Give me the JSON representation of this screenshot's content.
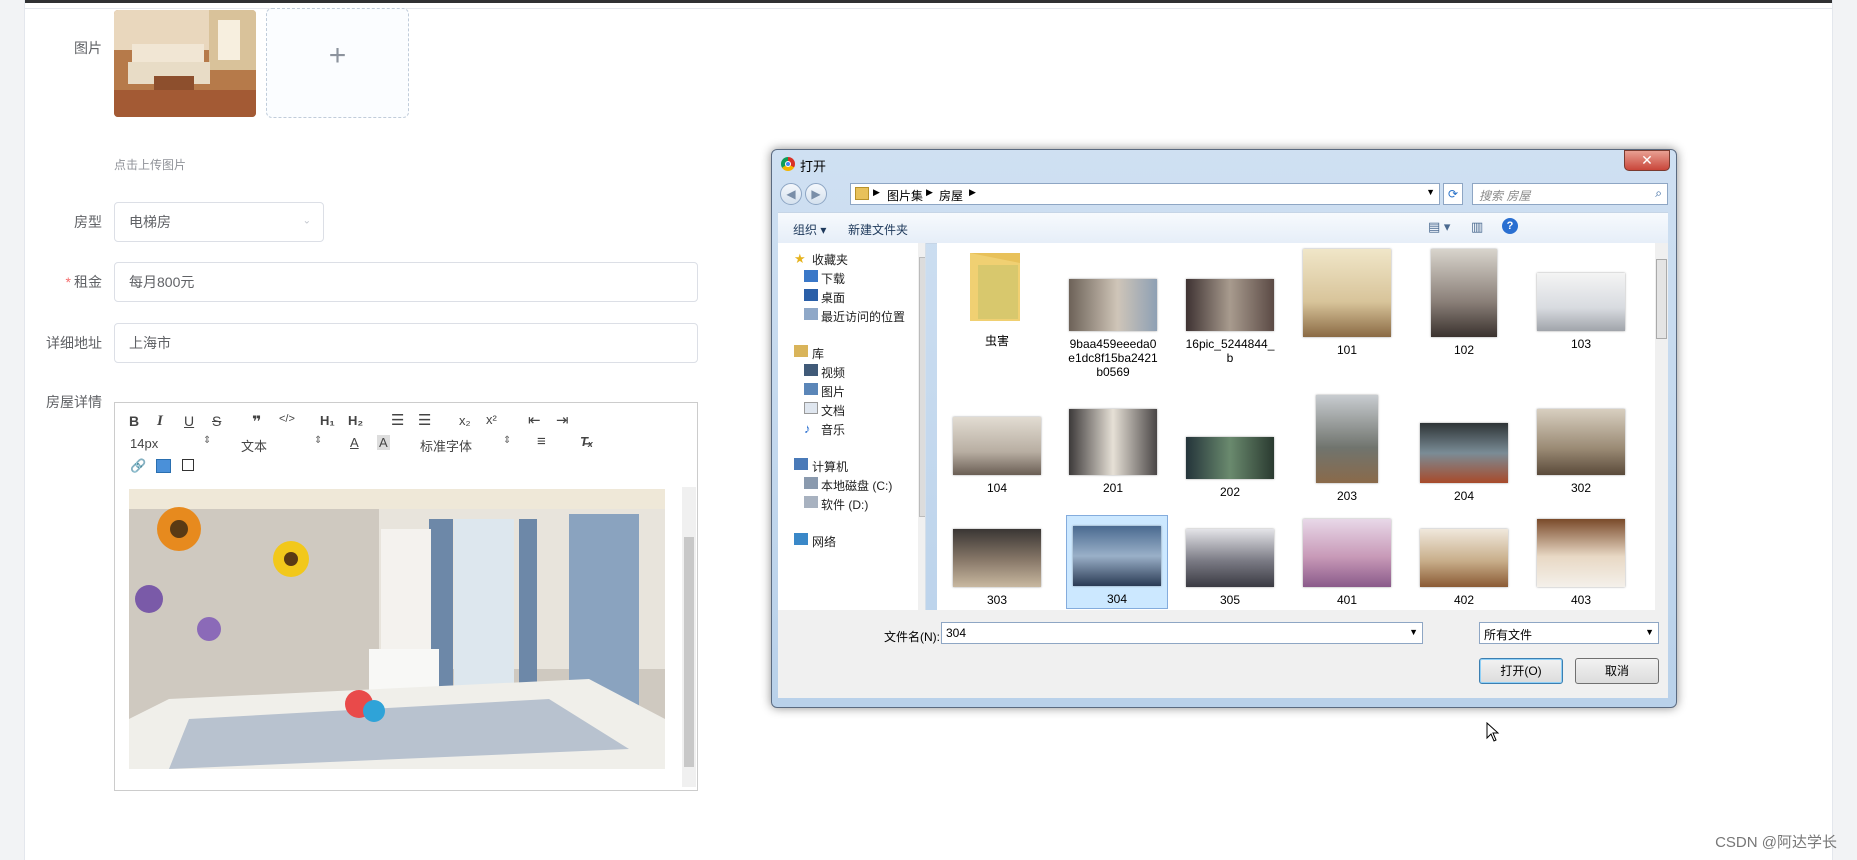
{
  "form": {
    "image_label": "图片",
    "upload_hint": "点击上传图片",
    "room_type_label": "房型",
    "room_type_value": "电梯房",
    "rent_label": "租金",
    "rent_value": "每月800元",
    "address_label": "详细地址",
    "address_value": "上海市",
    "detail_label": "房屋详情"
  },
  "editor": {
    "font_size": "14px",
    "block_type": "文本",
    "font_family": "标准字体"
  },
  "dialog": {
    "title": "打开",
    "breadcrumb": [
      "图片集",
      "房屋"
    ],
    "search_placeholder": "搜索 房屋",
    "organize": "组织 ▾",
    "new_folder": "新建文件夹",
    "nav": {
      "favorites": "收藏夹",
      "downloads": "下载",
      "desktop": "桌面",
      "recent": "最近访问的位置",
      "libraries": "库",
      "videos": "视频",
      "pictures": "图片",
      "documents": "文档",
      "music": "音乐",
      "computer": "计算机",
      "drive_c": "本地磁盘 (C:)",
      "drive_d": "软件 (D:)",
      "network": "网络"
    },
    "files": [
      {
        "name": "虫害",
        "kind": "folder"
      },
      {
        "name": "9baa459eeeda0e1dc8f15ba2421b0569",
        "kind": "image"
      },
      {
        "name": "16pic_5244844_b",
        "kind": "image"
      },
      {
        "name": "101",
        "kind": "image"
      },
      {
        "name": "102",
        "kind": "image"
      },
      {
        "name": "103",
        "kind": "image"
      },
      {
        "name": "104",
        "kind": "image"
      },
      {
        "name": "201",
        "kind": "image"
      },
      {
        "name": "202",
        "kind": "image"
      },
      {
        "name": "203",
        "kind": "image"
      },
      {
        "name": "204",
        "kind": "image"
      },
      {
        "name": "302",
        "kind": "image"
      },
      {
        "name": "303",
        "kind": "image"
      },
      {
        "name": "304",
        "kind": "image",
        "selected": true
      },
      {
        "name": "305",
        "kind": "image"
      },
      {
        "name": "401",
        "kind": "image"
      },
      {
        "name": "402",
        "kind": "image"
      },
      {
        "name": "403",
        "kind": "image"
      }
    ],
    "filename_label": "文件名(N):",
    "filename_value": "304",
    "filetype_value": "所有文件",
    "open_button": "打开(O)",
    "cancel_button": "取消"
  },
  "watermark": "CSDN @阿达学长",
  "colors": {
    "required": "#f56c6c",
    "selection": "#cce8ff",
    "dialog_frame": "#b9d1ea"
  }
}
